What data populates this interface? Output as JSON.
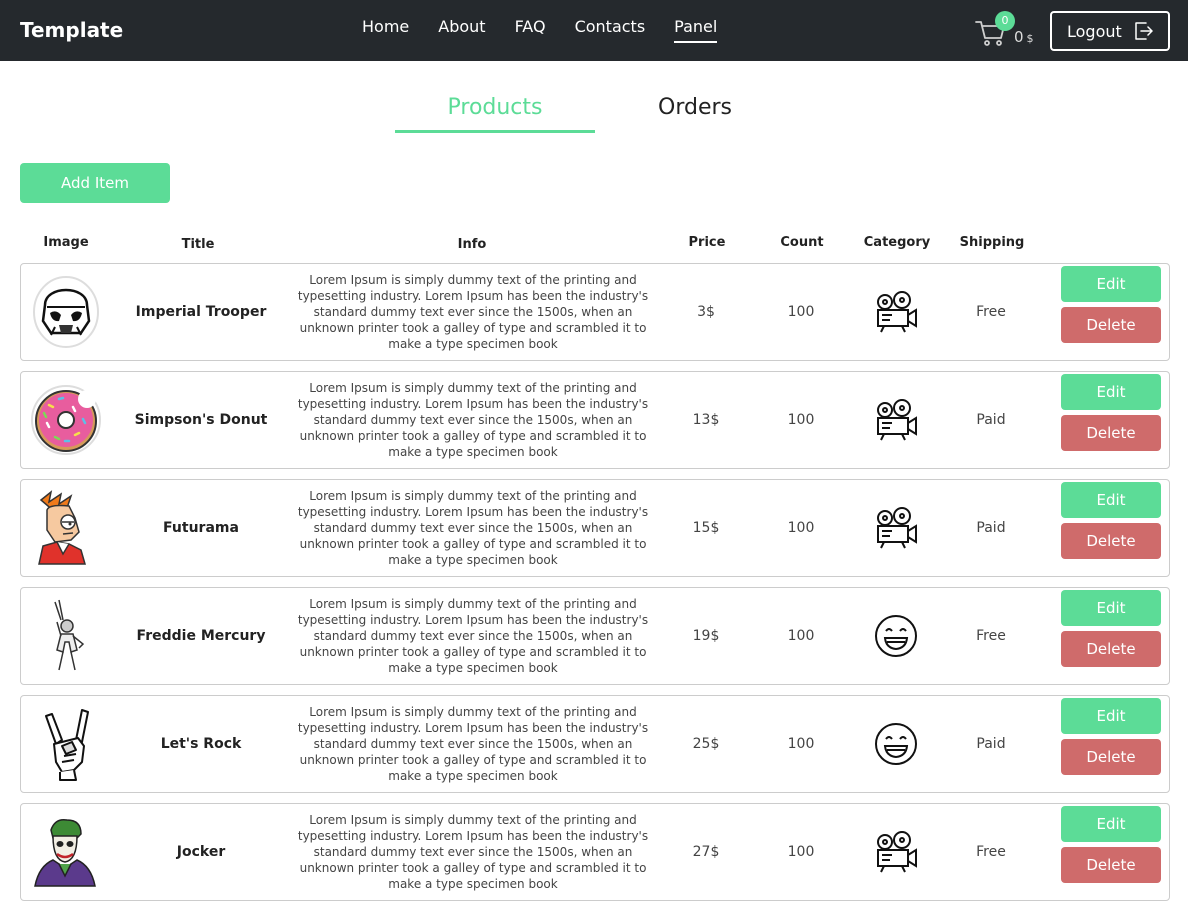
{
  "header": {
    "brand": "Template",
    "nav": [
      "Home",
      "About",
      "FAQ",
      "Contacts",
      "Panel"
    ],
    "active_nav": "Panel",
    "cart": {
      "badge": "0",
      "total": "0",
      "currency": "$"
    },
    "logout_label": "Logout"
  },
  "tabs": {
    "products": "Products",
    "orders": "Orders",
    "active": "Products"
  },
  "add_item_label": "Add Item",
  "columns": [
    "Image",
    "Title",
    "Info",
    "Price",
    "Count",
    "Category",
    "Shipping"
  ],
  "products": [
    {
      "title": "Imperial Trooper",
      "info": "Lorem Ipsum is simply dummy text of the printing and typesetting industry. Lorem Ipsum has been the industry's standard dummy text ever since the 1500s, when an unknown printer took a galley of type and scrambled it to make a type specimen book",
      "price": "3$",
      "count": "100",
      "category": "projector-icon",
      "shipping": "Free",
      "image": "stormtrooper-sticker",
      "edit": "Edit",
      "delete": "Delete"
    },
    {
      "title": "Simpson's Donut",
      "info": "Lorem Ipsum is simply dummy text of the printing and typesetting industry. Lorem Ipsum has been the industry's standard dummy text ever since the 1500s, when an unknown printer took a galley of type and scrambled it to make a type specimen book",
      "price": "13$",
      "count": "100",
      "category": "projector-icon",
      "shipping": "Paid",
      "image": "donut-sticker",
      "edit": "Edit",
      "delete": "Delete"
    },
    {
      "title": "Futurama",
      "info": "Lorem Ipsum is simply dummy text of the printing and typesetting industry. Lorem Ipsum has been the industry's standard dummy text ever since the 1500s, when an unknown printer took a galley of type and scrambled it to make a type specimen book",
      "price": "15$",
      "count": "100",
      "category": "projector-icon",
      "shipping": "Paid",
      "image": "fry-sticker",
      "edit": "Edit",
      "delete": "Delete"
    },
    {
      "title": "Freddie Mercury",
      "info": "Lorem Ipsum is simply dummy text of the printing and typesetting industry. Lorem Ipsum has been the industry's standard dummy text ever since the 1500s, when an unknown printer took a galley of type and scrambled it to make a type specimen book",
      "price": "19$",
      "count": "100",
      "category": "smiley-icon",
      "shipping": "Free",
      "image": "freddie-sticker",
      "edit": "Edit",
      "delete": "Delete"
    },
    {
      "title": "Let's Rock",
      "info": "Lorem Ipsum is simply dummy text of the printing and typesetting industry. Lorem Ipsum has been the industry's standard dummy text ever since the 1500s, when an unknown printer took a galley of type and scrambled it to make a type specimen book",
      "price": "25$",
      "count": "100",
      "category": "smiley-icon",
      "shipping": "Paid",
      "image": "rock-hand-sticker",
      "edit": "Edit",
      "delete": "Delete"
    },
    {
      "title": "Jocker",
      "info": "Lorem Ipsum is simply dummy text of the printing and typesetting industry. Lorem Ipsum has been the industry's standard dummy text ever since the 1500s, when an unknown printer took a galley of type and scrambled it to make a type specimen book",
      "price": "27$",
      "count": "100",
      "category": "projector-icon",
      "shipping": "Free",
      "image": "joker-sticker",
      "edit": "Edit",
      "delete": "Delete"
    }
  ],
  "colors": {
    "topbar": "#25292d",
    "accent": "#5cdc97",
    "danger": "#cf6b6b"
  }
}
